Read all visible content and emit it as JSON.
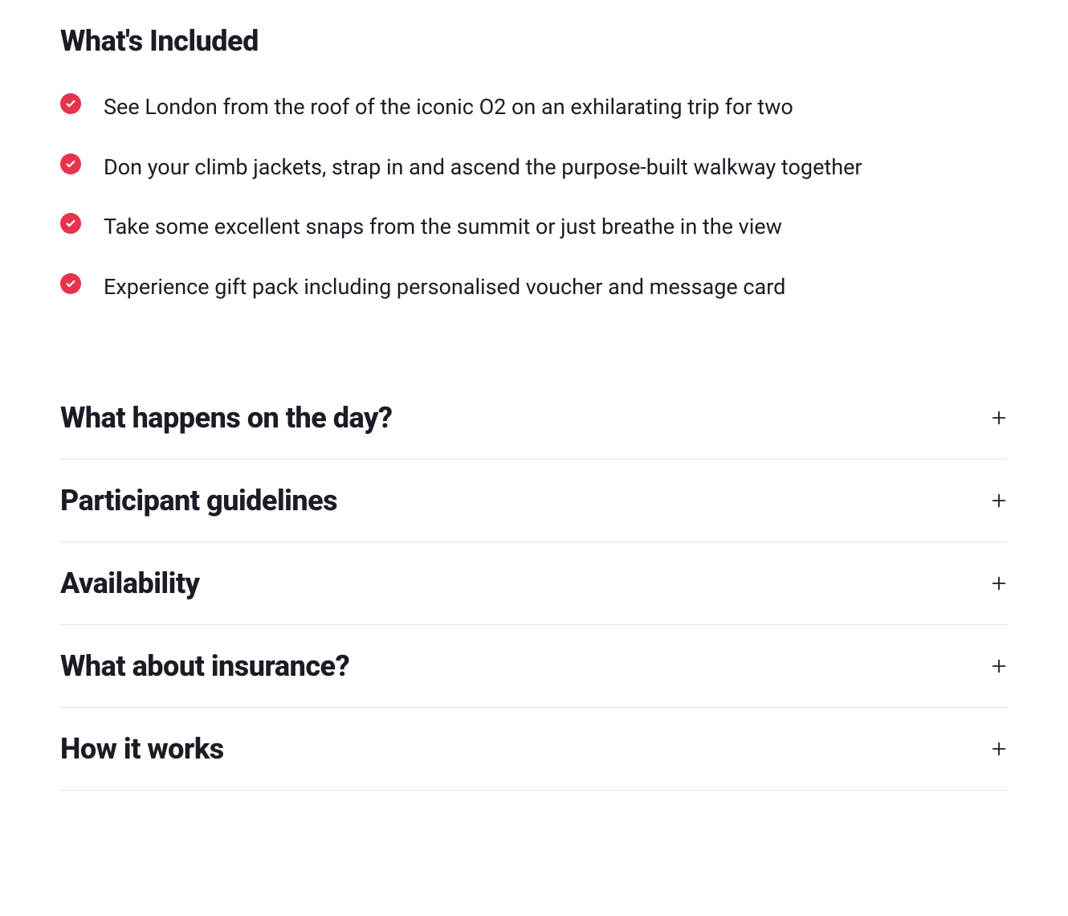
{
  "whats_included": {
    "heading": "What's Included",
    "items": [
      "See London from the roof of the iconic O2 on an exhilarating trip for two",
      "Don your climb jackets, strap in and ascend the purpose-built walkway together",
      "Take some excellent snaps from the summit or just breathe in the view",
      "Experience gift pack including personalised voucher and message card"
    ]
  },
  "accordion": {
    "items": [
      {
        "title": "What happens on the day?"
      },
      {
        "title": "Participant guidelines"
      },
      {
        "title": "Availability"
      },
      {
        "title": "What about insurance?"
      },
      {
        "title": "How it works"
      }
    ]
  }
}
